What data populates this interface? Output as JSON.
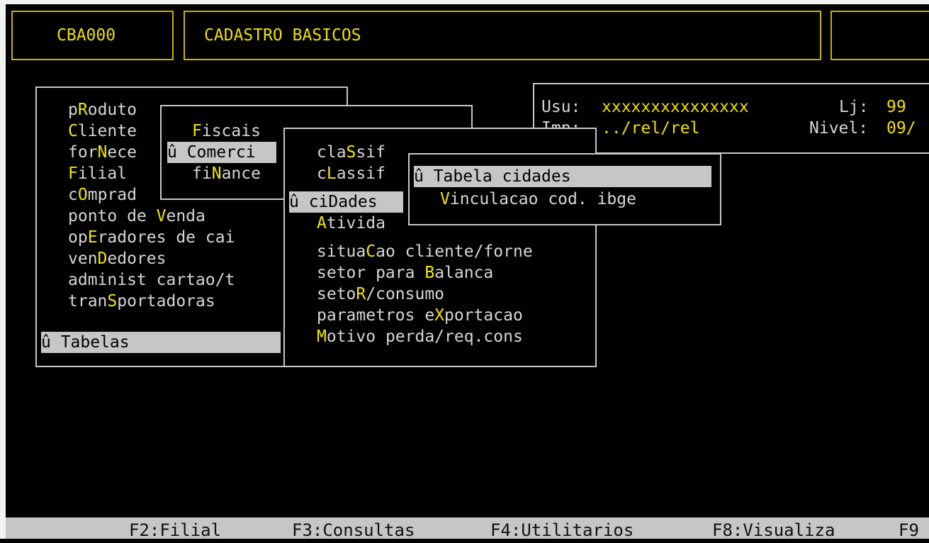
{
  "header": {
    "code": "CBA000",
    "title": "CADASTRO BASICOS"
  },
  "info": {
    "usu_label": "Usu:",
    "usu_value": "xxxxxxxxxxxxxxx",
    "lj_label": "Lj:",
    "lj_value": "99",
    "imp_label": "Imp:",
    "imp_value": "../rel/rel",
    "nivel_label": "Nivel:",
    "nivel_value": "09/"
  },
  "main_menu": {
    "items": [
      {
        "pre": "p",
        "hot": "R",
        "post": "oduto"
      },
      {
        "pre": "",
        "hot": "C",
        "post": "liente"
      },
      {
        "pre": "for",
        "hot": "N",
        "post": "ece"
      },
      {
        "pre": "",
        "hot": "F",
        "post": "ilial"
      },
      {
        "pre": "c",
        "hot": "O",
        "post": "mprad"
      },
      {
        "pre": "ponto de ",
        "hot": "V",
        "post": "enda"
      },
      {
        "pre": "op",
        "hot": "E",
        "post": "radores de cai"
      },
      {
        "pre": "ven",
        "hot": "D",
        "post": "edores"
      },
      {
        "pre": "administ cartao/t",
        "hot": "",
        "post": ""
      },
      {
        "pre": "tran",
        "hot": "S",
        "post": "portadoras"
      }
    ],
    "selected": "û Tabelas"
  },
  "cliente_menu": {
    "fiscais": {
      "pre": "",
      "hot": "F",
      "post": "iscais"
    },
    "comerci_selected": "û Comerci",
    "financeiro": {
      "pre": "fi",
      "hot": "N",
      "post": "ance"
    }
  },
  "tabelas_menu": {
    "items": [
      {
        "pre": "cla",
        "hot": "S",
        "post": "sif"
      },
      {
        "pre": "c",
        "hot": "L",
        "post": "assif"
      },
      {
        "pre": "",
        "hot": "",
        "post": ""
      },
      {
        "pre": "",
        "hot": "A",
        "post": "tivida"
      },
      {
        "pre": "situa",
        "hot": "C",
        "post": "ao cliente/forne"
      },
      {
        "pre": "setor para ",
        "hot": "B",
        "post": "alanca"
      },
      {
        "pre": "seto",
        "hot": "R",
        "post": "/consumo"
      },
      {
        "pre": "parametros e",
        "hot": "X",
        "post": "portacao"
      },
      {
        "pre": "",
        "hot": "M",
        "post": "otivo perda/req.cons"
      }
    ],
    "selected": "û ciDades"
  },
  "cidades_menu": {
    "selected": "û Tabela cidades",
    "item": {
      "pre": "",
      "hot": "V",
      "post": "inculacao cod. ibge"
    }
  },
  "function_bar": {
    "keys": [
      "F2:Filial",
      "F3:Consultas",
      "F4:Utilitarios",
      "F8:Visualiza",
      "F9"
    ]
  }
}
